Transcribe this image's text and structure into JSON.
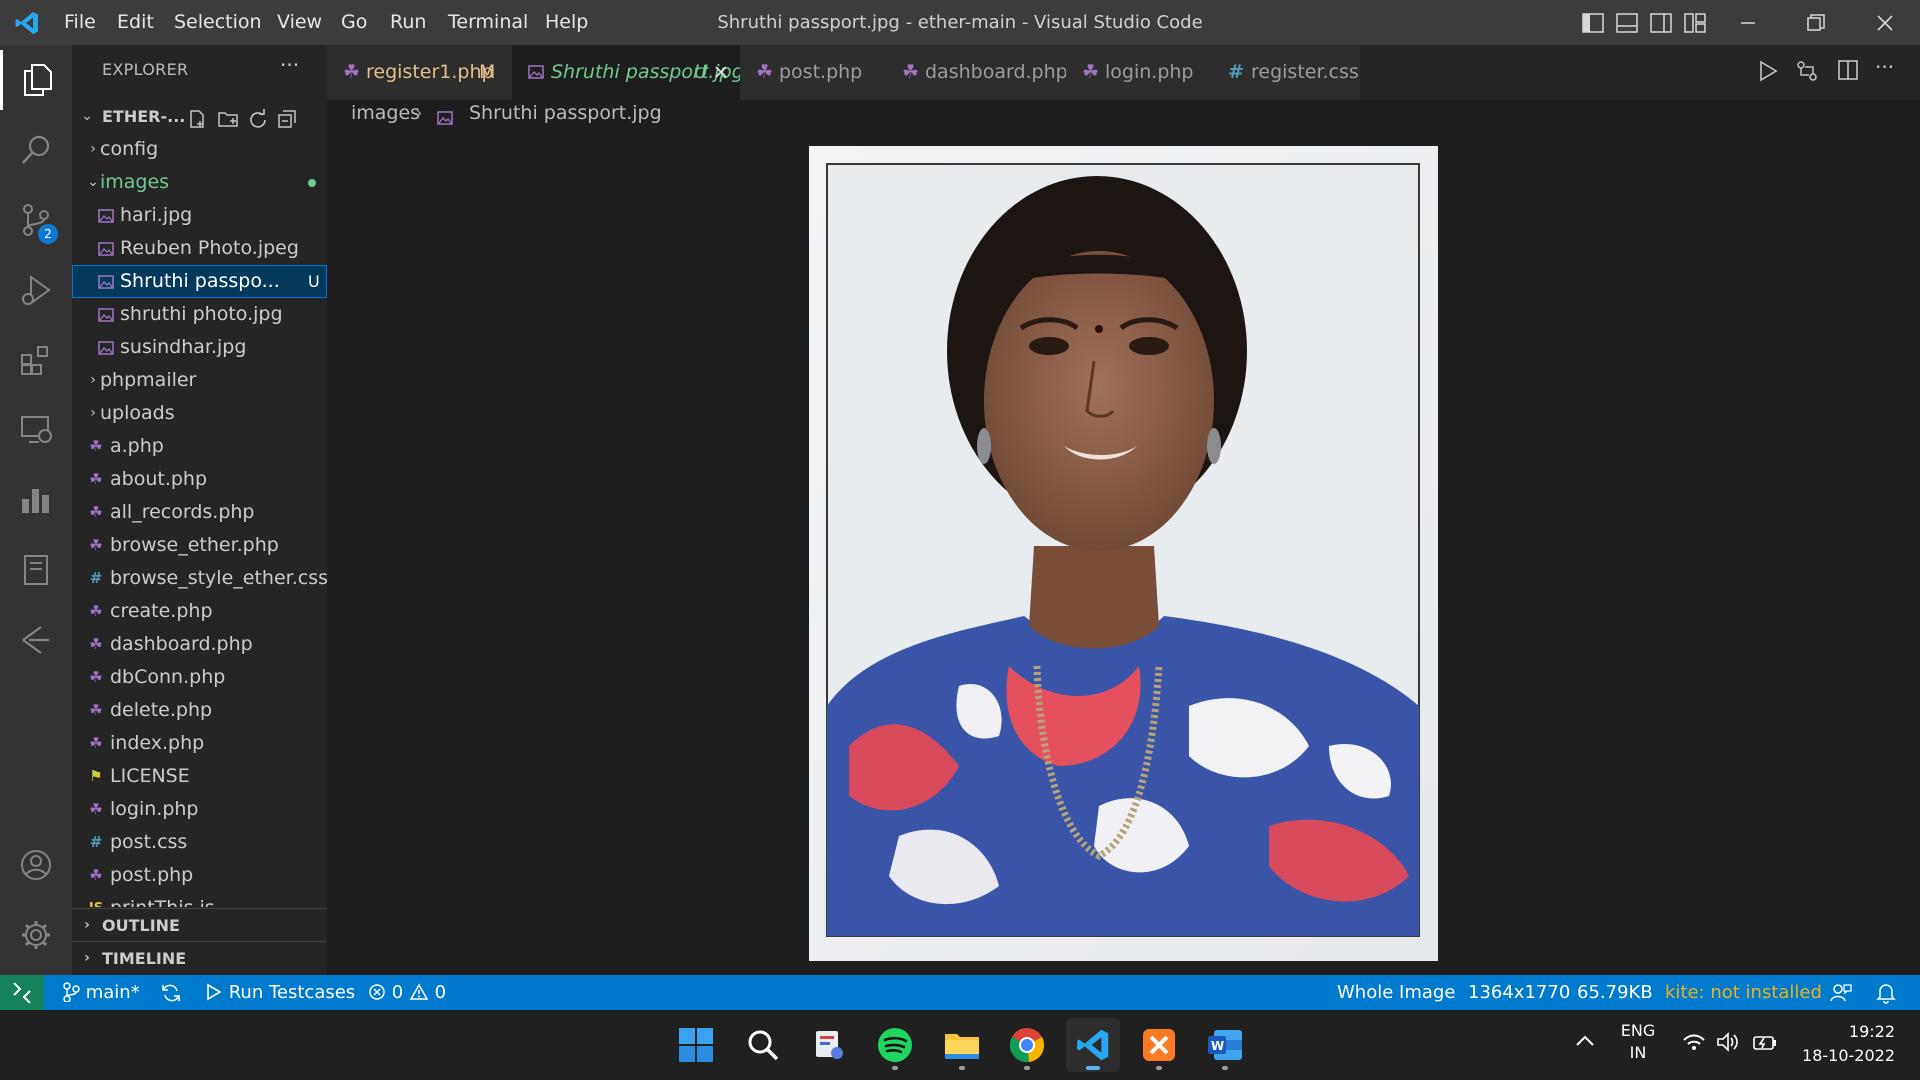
{
  "window": {
    "title": "Shruthi passport.jpg - ether-main - Visual Studio Code",
    "menu": [
      "File",
      "Edit",
      "Selection",
      "View",
      "Go",
      "Run",
      "Terminal",
      "Help"
    ]
  },
  "activity": {
    "scm_badge": "2"
  },
  "sidebar": {
    "header": "EXPLORER",
    "more": "···",
    "project": "ETHER-...",
    "tree": [
      {
        "label": "config",
        "type": "folder",
        "open": false
      },
      {
        "label": "images",
        "type": "folder",
        "open": true
      },
      {
        "label": "hari.jpg",
        "type": "image"
      },
      {
        "label": "Reuben Photo.jpeg",
        "type": "image"
      },
      {
        "label": "Shruthi passpo...",
        "type": "image",
        "status": "U",
        "selected": true
      },
      {
        "label": "shruthi photo.jpg",
        "type": "image"
      },
      {
        "label": "susindhar.jpg",
        "type": "image"
      },
      {
        "label": "phpmailer",
        "type": "folder",
        "open": false
      },
      {
        "label": "uploads",
        "type": "folder",
        "open": false
      },
      {
        "label": "a.php",
        "type": "php"
      },
      {
        "label": "about.php",
        "type": "php"
      },
      {
        "label": "all_records.php",
        "type": "php"
      },
      {
        "label": "browse_ether.php",
        "type": "php"
      },
      {
        "label": "browse_style_ether.css",
        "type": "css"
      },
      {
        "label": "create.php",
        "type": "php"
      },
      {
        "label": "dashboard.php",
        "type": "php"
      },
      {
        "label": "dbConn.php",
        "type": "php"
      },
      {
        "label": "delete.php",
        "type": "php"
      },
      {
        "label": "index.php",
        "type": "php"
      },
      {
        "label": "LICENSE",
        "type": "license"
      },
      {
        "label": "login.php",
        "type": "php"
      },
      {
        "label": "post.css",
        "type": "css"
      },
      {
        "label": "post.php",
        "type": "php"
      },
      {
        "label": "printThis.js",
        "type": "js"
      }
    ],
    "outline": "OUTLINE",
    "timeline": "TIMELINE"
  },
  "tabs": [
    {
      "label": "register1.php",
      "status": "M",
      "type": "php"
    },
    {
      "label": "Shruthi passport.jpg",
      "status": "U",
      "type": "image",
      "active": true
    },
    {
      "label": "post.php",
      "type": "php"
    },
    {
      "label": "dashboard.php",
      "type": "php"
    },
    {
      "label": "login.php",
      "type": "php"
    },
    {
      "label": "register.css",
      "type": "css"
    }
  ],
  "breadcrumb": {
    "folder": "images",
    "file": "Shruthi passport.jpg"
  },
  "status": {
    "branch": "main*",
    "run": "Run Testcases",
    "errors": "0",
    "warnings": "0",
    "zoom": "Whole Image",
    "dimensions": "1364x1770",
    "size": "65.79KB",
    "kite": "kite: not installed"
  },
  "taskbar": {
    "lang1": "ENG",
    "lang2": "IN",
    "time": "19:22",
    "date": "18-10-2022"
  },
  "colors": {
    "accent": "#007acc",
    "untracked": "#73c991",
    "modified": "#e2c08d",
    "kite": "#e6b422"
  }
}
